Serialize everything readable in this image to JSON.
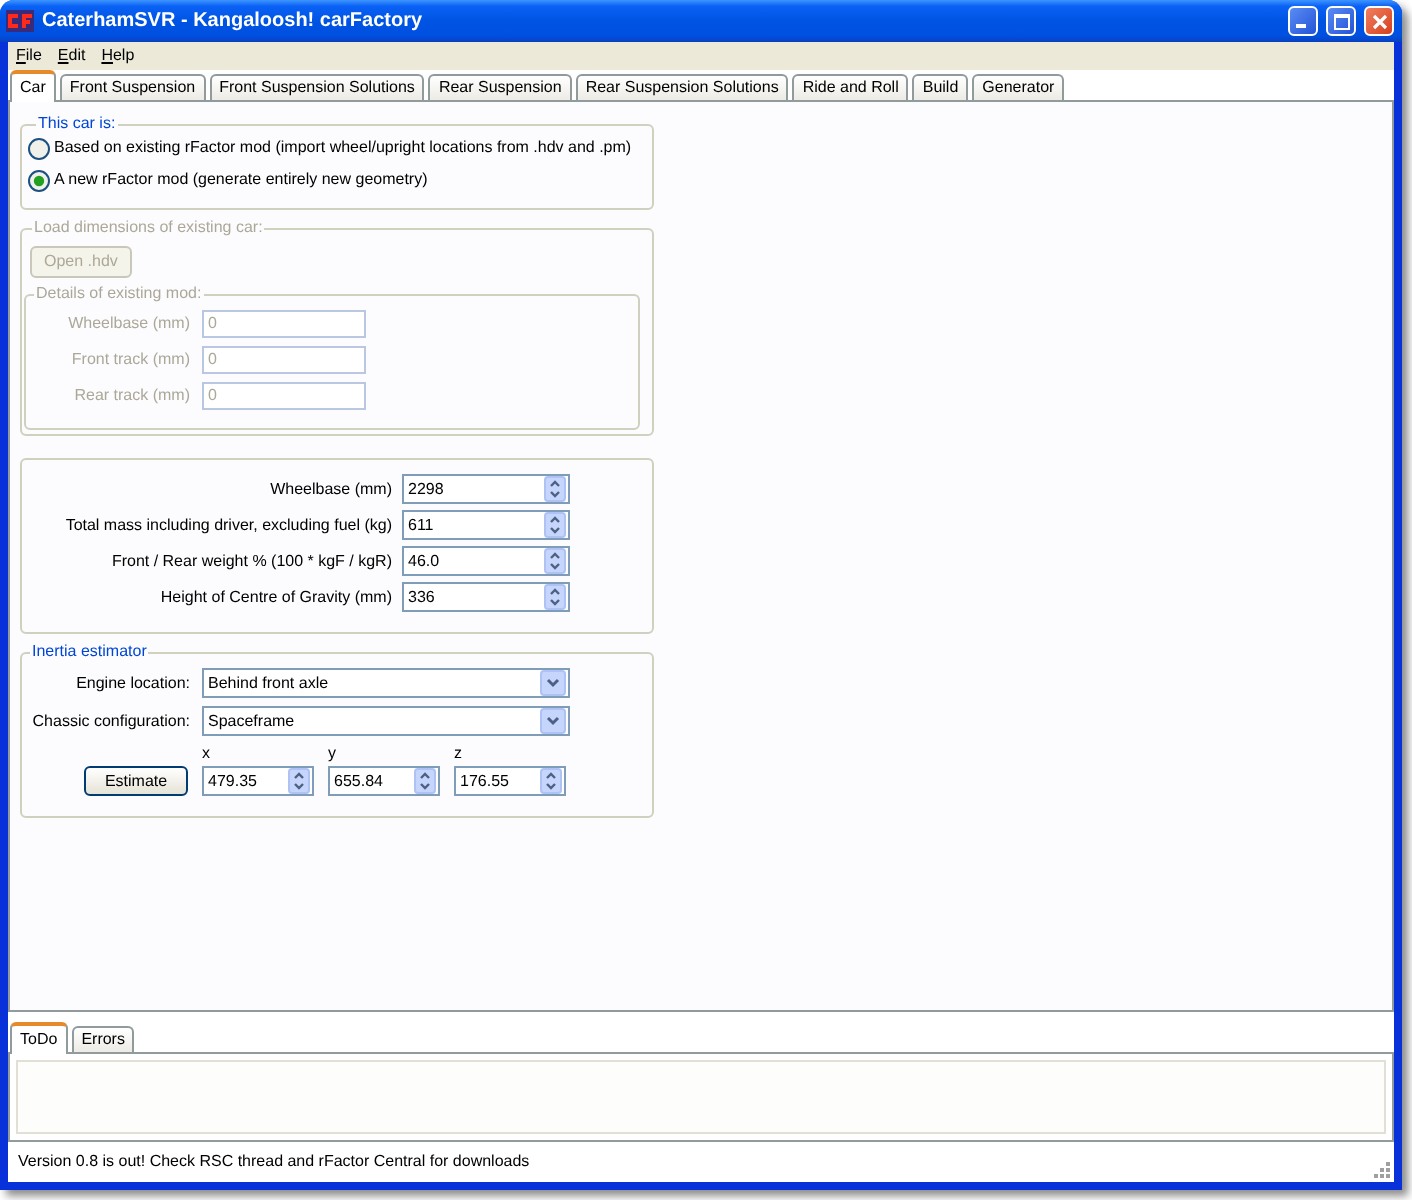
{
  "window": {
    "title": "CaterhamSVR - Kangaloosh! carFactory"
  },
  "menu": [
    "File",
    "Edit",
    "Help"
  ],
  "tabs": [
    {
      "label": "Car",
      "selected": true
    },
    {
      "label": "Front Suspension",
      "selected": false
    },
    {
      "label": "Front Suspension Solutions",
      "selected": false
    },
    {
      "label": "Rear Suspension",
      "selected": false
    },
    {
      "label": "Rear Suspension Solutions",
      "selected": false
    },
    {
      "label": "Ride and Roll",
      "selected": false
    },
    {
      "label": "Build",
      "selected": false
    },
    {
      "label": "Generator",
      "selected": false
    }
  ],
  "car_type": {
    "title": "This car is:",
    "options": [
      {
        "label": "Based on existing rFactor mod (import wheel/upright locations from .hdv and .pm)",
        "selected": false
      },
      {
        "label": "A new rFactor mod (generate entirely new geometry)",
        "selected": true
      }
    ]
  },
  "existing_car": {
    "title": "Load dimensions of existing car:",
    "disabled": true,
    "button": "Open .hdv",
    "details": {
      "title": "Details of existing mod:",
      "fields": [
        {
          "label": "Wheelbase (mm)",
          "value": "0"
        },
        {
          "label": "Front track (mm)",
          "value": "0"
        },
        {
          "label": "Rear track (mm)",
          "value": "0"
        }
      ]
    }
  },
  "dimensions": {
    "fields": [
      {
        "label": "Wheelbase (mm)",
        "value": "2298"
      },
      {
        "label": "Total mass including driver, excluding fuel (kg)",
        "value": "611"
      },
      {
        "label": "Front / Rear weight % (100 * kgF / kgR)",
        "value": "46.0"
      },
      {
        "label": "Height of Centre of Gravity (mm)",
        "value": "336"
      }
    ]
  },
  "inertia_estimator": {
    "title": "Inertia estimator",
    "selects": [
      {
        "label": "Engine location:",
        "value": "Behind front axle"
      },
      {
        "label": "Chassic configuration:",
        "value": "Spaceframe"
      }
    ],
    "button": "Estimate",
    "outputs": [
      {
        "label": "x",
        "value": "479.35"
      },
      {
        "label": "y",
        "value": "655.84"
      },
      {
        "label": "z",
        "value": "176.55"
      }
    ]
  },
  "bottom_tabs": [
    {
      "label": "ToDo",
      "selected": true
    },
    {
      "label": "Errors",
      "selected": false
    }
  ],
  "status_bar": {
    "text": "Version 0.8 is out! Check RSC thread and rFactor Central for downloads"
  }
}
